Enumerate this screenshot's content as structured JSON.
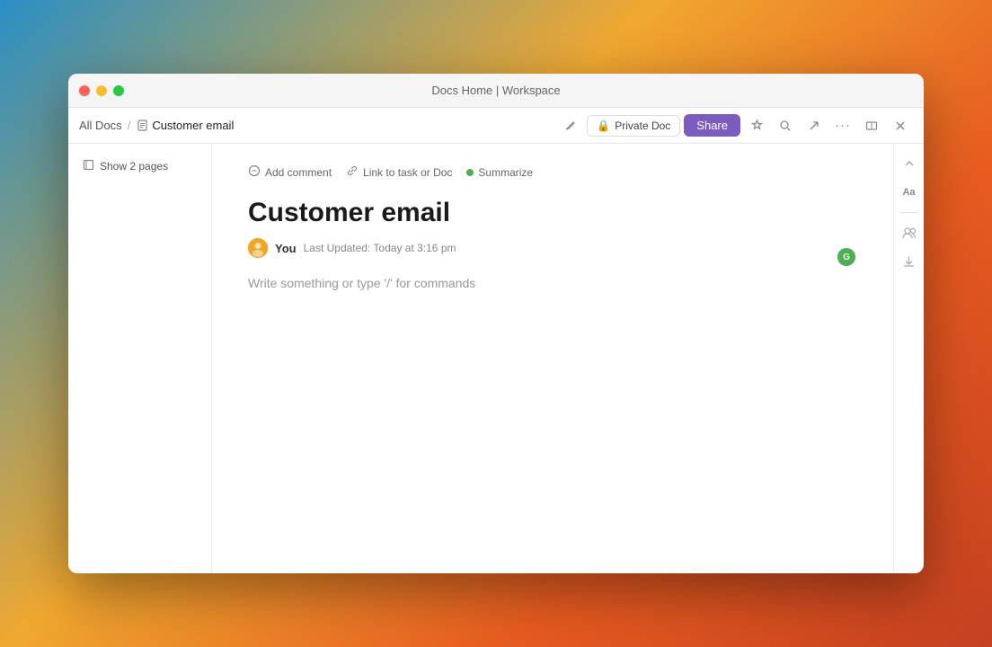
{
  "window": {
    "title": "Docs Home | Workspace"
  },
  "titlebar": {
    "title": "Docs Home | Workspace"
  },
  "toolbar": {
    "breadcrumb": {
      "parent": "All Docs",
      "separator": "/",
      "current": "Customer email"
    },
    "buttons": {
      "private_doc": "Private Doc",
      "share": "Share",
      "lock_icon": "🔒",
      "star_icon": "☆",
      "search_icon": "🔍",
      "export_icon": "↗",
      "more_icon": "···",
      "minimize_icon": "⤡",
      "close_icon": "✕"
    }
  },
  "sidebar": {
    "show_pages_label": "Show 2 pages",
    "pages_icon": "□"
  },
  "doc": {
    "actions": {
      "add_comment": "Add comment",
      "link_task": "Link to task or Doc",
      "summarize": "Summarize"
    },
    "title": "Customer email",
    "meta": {
      "author": "You",
      "updated_label": "Last Updated: Today at 3:16 pm"
    },
    "placeholder": "Write something or type '/' for commands"
  },
  "right_sidebar": {
    "text_icon": "Aa",
    "spacer1": "",
    "users_icon": "👥",
    "download_icon": "↓"
  },
  "ai_indicator": {
    "label": "G",
    "color": "#4CAF50"
  },
  "colors": {
    "share_btn": "#7c5cbf",
    "ai_green": "#4CAF50"
  }
}
